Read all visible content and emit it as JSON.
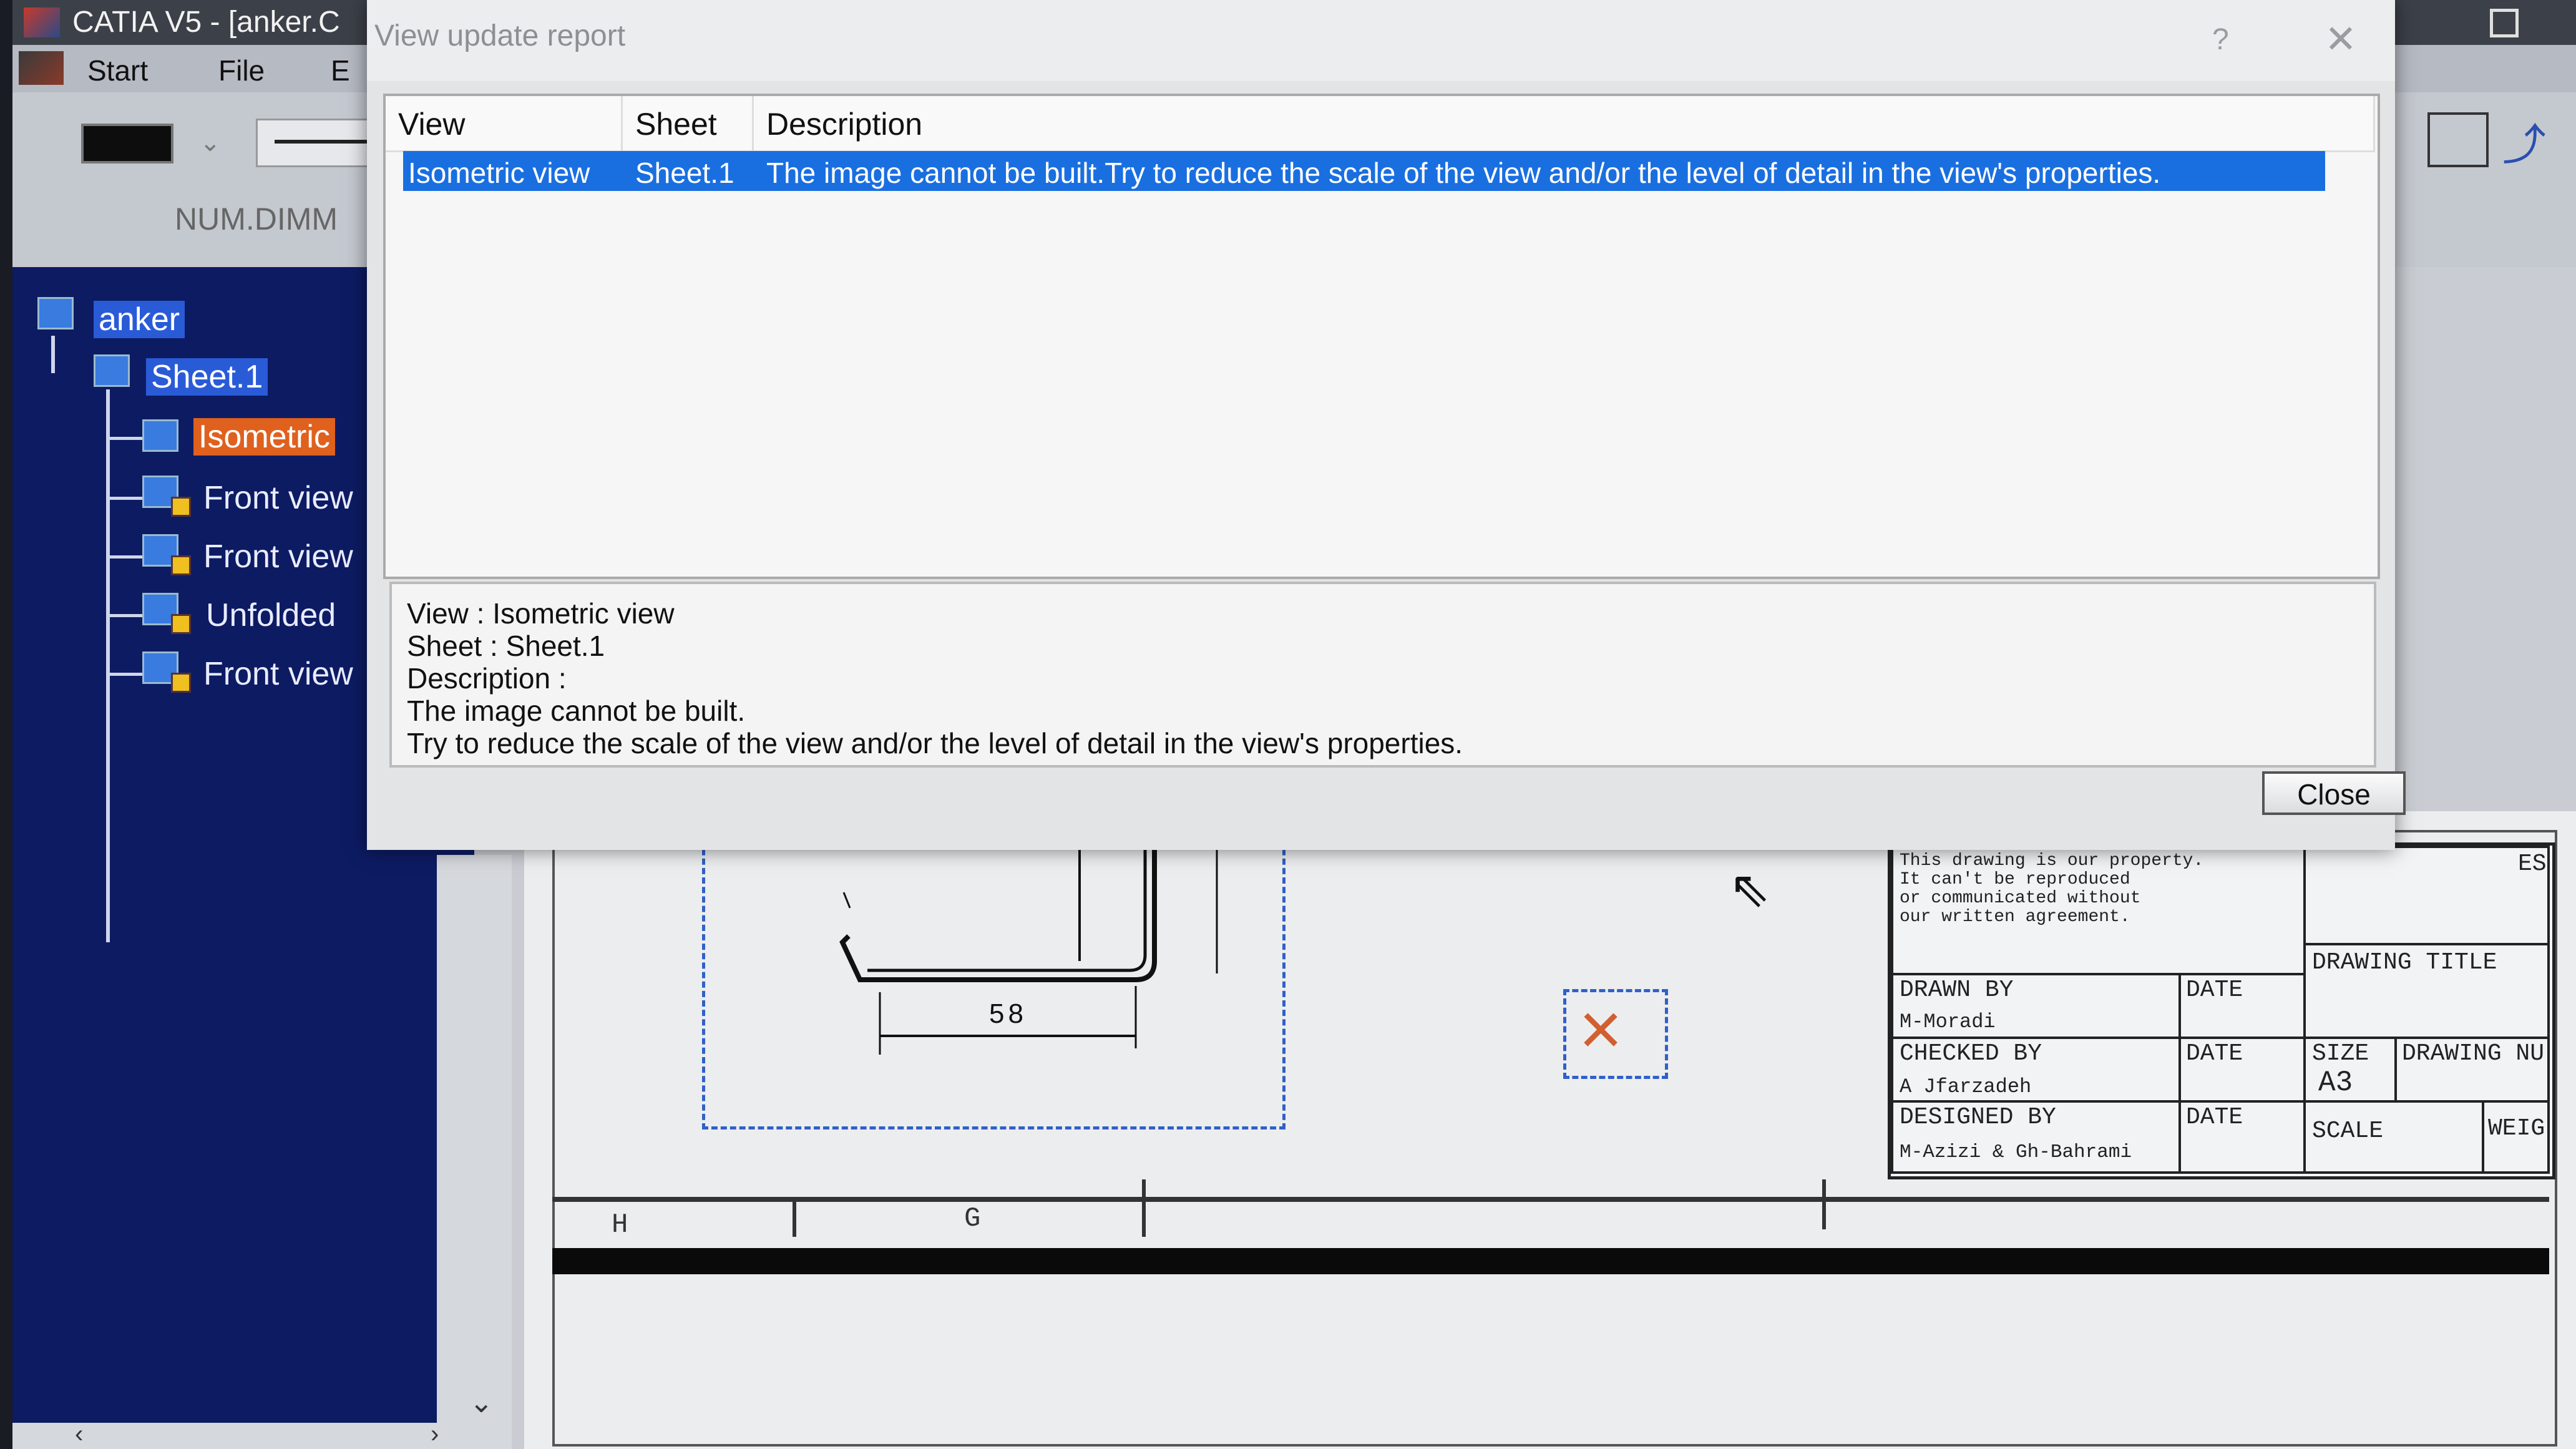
{
  "app": {
    "title": "CATIA V5 - [anker.C",
    "menu": {
      "start": "Start",
      "file": "File",
      "edit": "E"
    },
    "toolbar": {
      "num_dimm": "NUM.DIMM"
    }
  },
  "tree": {
    "root": "anker",
    "sheet": "Sheet.1",
    "items": [
      {
        "label": "Isometric"
      },
      {
        "label": "Front view"
      },
      {
        "label": "Front view"
      },
      {
        "label": "Unfolded"
      },
      {
        "label": "Front view"
      }
    ]
  },
  "dialog": {
    "title": "View update report",
    "help": "?",
    "columns": {
      "view": "View",
      "sheet": "Sheet",
      "description": "Description"
    },
    "rows": [
      {
        "view": "Isometric view",
        "sheet": "Sheet.1",
        "description": "The image cannot be built.Try to reduce the scale of the view and/or the level of detail in the view's properties."
      }
    ],
    "detail": {
      "line1": "View : Isometric view",
      "line2": "Sheet : Sheet.1",
      "line3": "Description :",
      "line4": "The image cannot be built.",
      "line5": "Try to reduce the scale of the view and/or the level of detail in the view's properties."
    },
    "close_label": "Close"
  },
  "drawing": {
    "dimension": "58",
    "zones": {
      "h": "H",
      "g": "G"
    },
    "title_block": {
      "property_note": [
        "This drawing is our property.",
        "It can't be reproduced",
        "or communicated without",
        "our written agreement."
      ],
      "drawn_by_label": "DRAWN BY",
      "drawn_by": "M-Moradi",
      "checked_by_label": "CHECKED BY",
      "checked_by": "A Jfarzadeh",
      "designed_by_label": "DESIGNED BY",
      "designed_by": "M-Azizi & Gh-Bahrami",
      "date_label": "DATE",
      "drawing_title_label": "DRAWING TITLE",
      "size_label": "SIZE",
      "size": "A3",
      "drawing_number_label": "DRAWING NU",
      "scale_label": "SCALE",
      "weight_label": "WEIG",
      "corner_label": "ES"
    }
  }
}
